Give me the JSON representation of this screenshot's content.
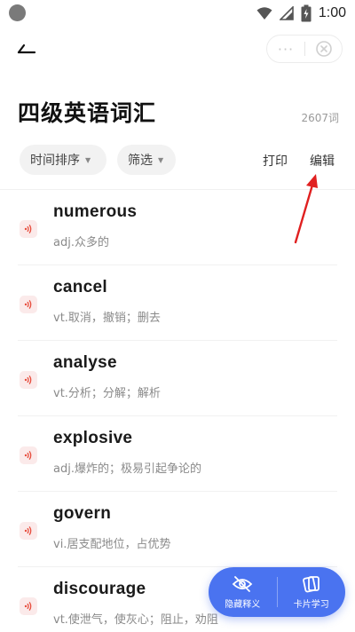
{
  "status_bar": {
    "time": "1:00"
  },
  "header": {
    "title": "四级英语词汇",
    "count": "2607词",
    "capsule_more": "···"
  },
  "toolbar": {
    "sort_label": "时间排序",
    "filter_label": "筛选",
    "print_label": "打印",
    "edit_label": "编辑"
  },
  "words": [
    {
      "word": "numerous",
      "meaning": "adj.众多的"
    },
    {
      "word": "cancel",
      "meaning": "vt.取消，撤销；删去"
    },
    {
      "word": "analyse",
      "meaning": "vt.分析；分解；解析"
    },
    {
      "word": "explosive",
      "meaning": "adj.爆炸的；极易引起争论的"
    },
    {
      "word": "govern",
      "meaning": "vi.居支配地位，占优势"
    },
    {
      "word": "discourage",
      "meaning": "vt.使泄气，使灰心；阻止，劝阻"
    }
  ],
  "fab": {
    "hide_label": "隐藏释义",
    "card_label": "卡片学习"
  },
  "colors": {
    "accent": "#4a73f0",
    "speaker": "#e74c3c",
    "annotation_arrow": "#e02020"
  }
}
